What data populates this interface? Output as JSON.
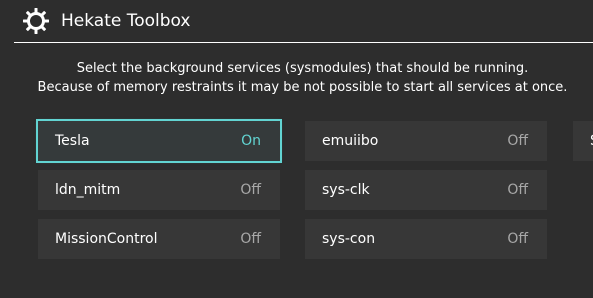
{
  "header": {
    "title": "Hekate Toolbox",
    "icon": "gear-icon"
  },
  "description": {
    "line1": "Select the background services (sysmodules) that should be running.",
    "line2": "Because of memory restraints it may be not possible to start all services at once."
  },
  "colors": {
    "background": "#2d2d2d",
    "tile": "#373737",
    "accent": "#62d4d2",
    "status_off": "#a8a8a8"
  },
  "services": [
    {
      "name": "Tesla",
      "status": "On",
      "selected": true
    },
    {
      "name": "emuiibo",
      "status": "Off",
      "selected": false
    },
    {
      "name": "ldn_mitm",
      "status": "Off",
      "selected": false
    },
    {
      "name": "sys-clk",
      "status": "Off",
      "selected": false
    },
    {
      "name": "MissionControl",
      "status": "Off",
      "selected": false
    },
    {
      "name": "sys-con",
      "status": "Off",
      "selected": false
    }
  ],
  "partial_column": {
    "visible_text": "S"
  }
}
